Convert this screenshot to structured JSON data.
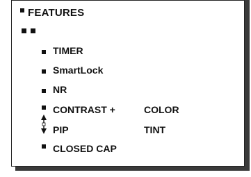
{
  "menu": {
    "title": "FEATURES",
    "items": [
      {
        "label": "TIMER"
      },
      {
        "label": "SmartLock"
      },
      {
        "label": "NR"
      },
      {
        "label": "CONTRAST +"
      },
      {
        "label": "PIP"
      },
      {
        "label": "CLOSED CAP"
      }
    ],
    "right_column": [
      {
        "label": "COLOR"
      },
      {
        "label": "TINT"
      }
    ]
  },
  "icons": {
    "title_marker": "square-bullet-icon",
    "submenu_marker": "double-square-icon",
    "item_marker": "square-bullet-icon",
    "selection_cursor": "up-down-arrow-icon"
  },
  "colors": {
    "text": "#111111",
    "panel_bg": "#ffffff",
    "shadow": "#3a3a3a"
  }
}
